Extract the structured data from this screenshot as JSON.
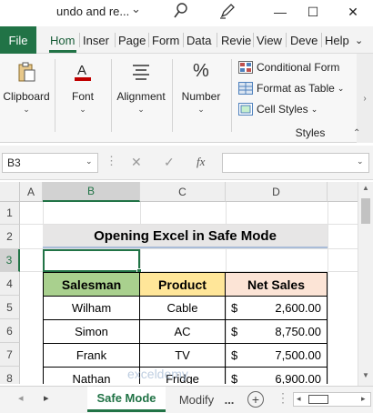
{
  "window": {
    "title": "undo and re...",
    "minimize": "—",
    "maximize": "☐",
    "close": "✕"
  },
  "ribbon_tabs": [
    "File",
    "Hom",
    "Inser",
    "Page",
    "Form",
    "Data",
    "Revie",
    "View",
    "Deve",
    "Help"
  ],
  "ribbon": {
    "clipboard": "Clipboard",
    "font": "Font",
    "alignment": "Alignment",
    "number": "Number",
    "styles_group": "Styles",
    "conditional_formatting": "Conditional Form",
    "format_as_table": "Format as Table",
    "cell_styles": "Cell Styles"
  },
  "formula_bar": {
    "name_box": "B3",
    "fx": "fx",
    "cancel": "✕",
    "enter": "✓",
    "formula": ""
  },
  "columns": [
    "A",
    "B",
    "C",
    "D"
  ],
  "rows": [
    "1",
    "2",
    "3",
    "4",
    "5",
    "6",
    "7",
    "8"
  ],
  "sheet": {
    "title": "Opening Excel in Safe Mode",
    "headers": [
      "Salesman",
      "Product",
      "Net Sales"
    ],
    "data": [
      {
        "salesman": "Wilham",
        "product": "Cable",
        "currency": "$",
        "net_sales": "2,600.00"
      },
      {
        "salesman": "Simon",
        "product": "AC",
        "currency": "$",
        "net_sales": "8,750.00"
      },
      {
        "salesman": "Frank",
        "product": "TV",
        "currency": "$",
        "net_sales": "7,500.00"
      },
      {
        "salesman": "Nathan",
        "product": "Fridge",
        "currency": "$",
        "net_sales": "6,900.00"
      }
    ]
  },
  "sheet_tabs": {
    "active": "Safe Mode",
    "other": "Modify",
    "more": "...",
    "add": "+"
  },
  "watermark": "exceldemy EXCEL · DATA · BI",
  "colors": {
    "excel_green": "#217346",
    "salesman_header": "#a9d08e",
    "product_header": "#ffe699",
    "net_sales_header": "#fce4d6",
    "title_band": "#e7e6e6"
  }
}
